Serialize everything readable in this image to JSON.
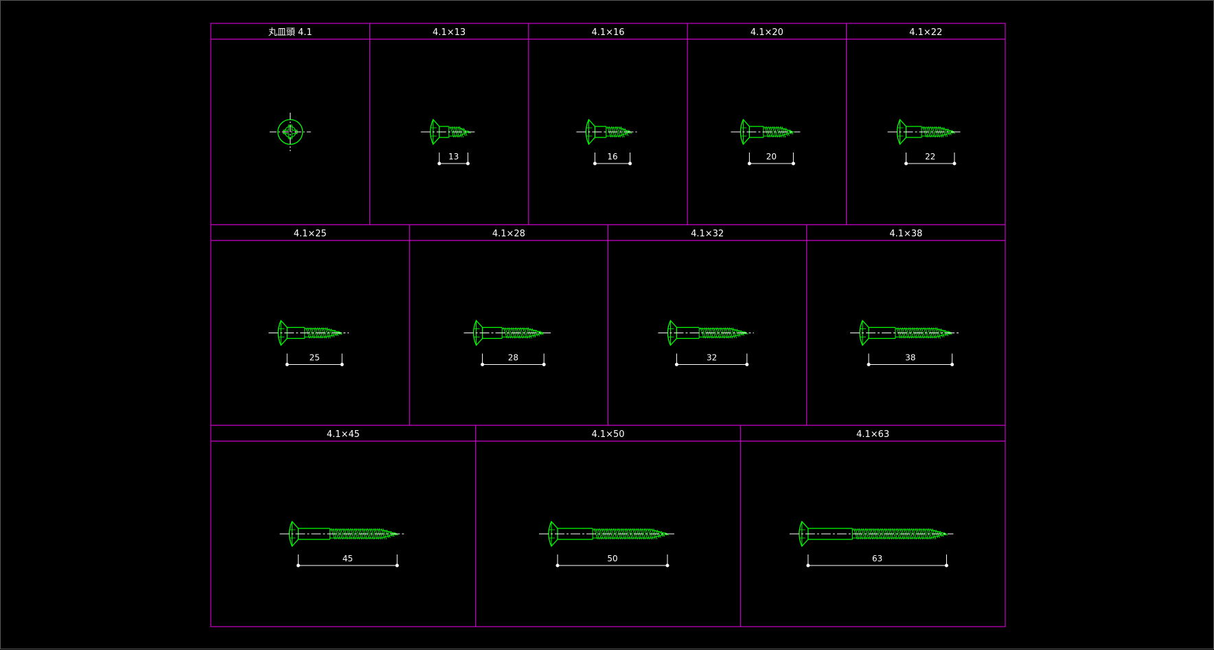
{
  "sheet": {
    "colors": {
      "background": "#000000",
      "frame": "#cc00cc",
      "screw": "#00ff00",
      "centerline": "#ffffff",
      "dimension": "#ffffff",
      "text": "#ffffff"
    },
    "rows": [
      {
        "cells": [
          {
            "label": "丸皿頭 4.1",
            "view": "head-top"
          },
          {
            "label": "4.1×13",
            "view": "side",
            "length": 13,
            "dim_label": "13"
          },
          {
            "label": "4.1×16",
            "view": "side",
            "length": 16,
            "dim_label": "16"
          },
          {
            "label": "4.1×20",
            "view": "side",
            "length": 20,
            "dim_label": "20"
          },
          {
            "label": "4.1×22",
            "view": "side",
            "length": 22,
            "dim_label": "22"
          }
        ]
      },
      {
        "cells": [
          {
            "label": "4.1×25",
            "view": "side",
            "length": 25,
            "dim_label": "25"
          },
          {
            "label": "4.1×28",
            "view": "side",
            "length": 28,
            "dim_label": "28"
          },
          {
            "label": "4.1×32",
            "view": "side",
            "length": 32,
            "dim_label": "32"
          },
          {
            "label": "4.1×38",
            "view": "side",
            "length": 38,
            "dim_label": "38"
          }
        ]
      },
      {
        "cells": [
          {
            "label": "4.1×45",
            "view": "side",
            "length": 45,
            "dim_label": "45"
          },
          {
            "label": "4.1×50",
            "view": "side",
            "length": 50,
            "dim_label": "50"
          },
          {
            "label": "4.1×63",
            "view": "side",
            "length": 63,
            "dim_label": "63"
          }
        ]
      }
    ]
  }
}
